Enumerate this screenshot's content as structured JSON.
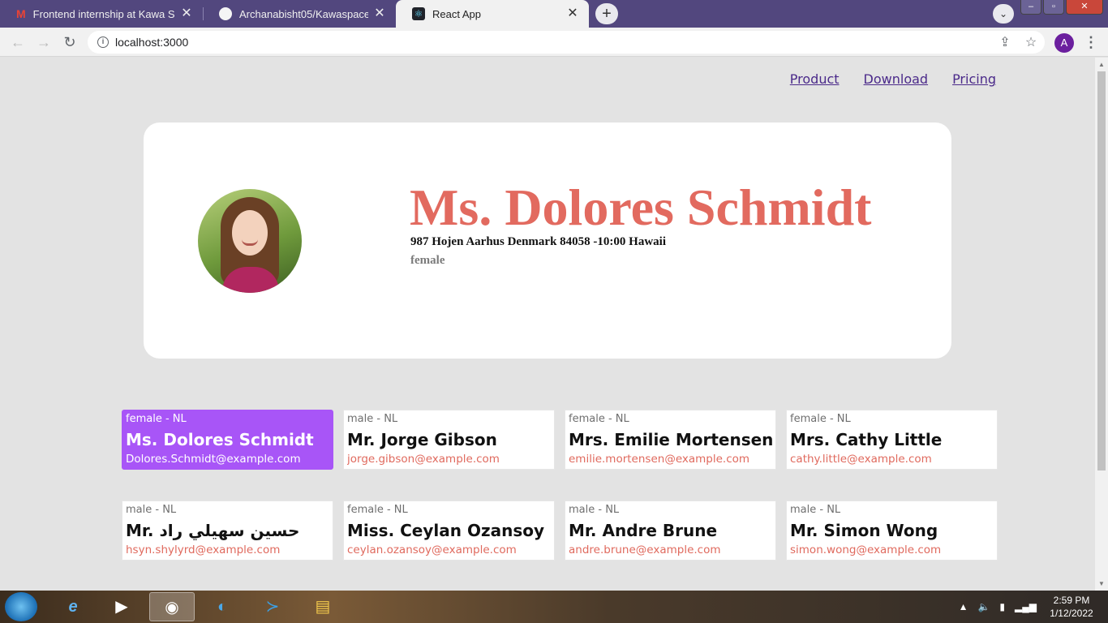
{
  "browser": {
    "tabs": [
      {
        "title": "Frontend internship at Kawa Space",
        "icon": "gmail-icon",
        "active": false
      },
      {
        "title": "Archanabisht05/Kawaspace",
        "icon": "github-icon",
        "active": false
      },
      {
        "title": "React App",
        "icon": "react-icon",
        "active": true
      }
    ],
    "url": "localhost:3000",
    "profile_initial": "A"
  },
  "nav": {
    "links": [
      "Product",
      "Download",
      "Pricing"
    ]
  },
  "profile": {
    "name": "Ms. Dolores Schmidt",
    "address": "987 Hojen Aarhus Denmark 84058 -10:00 Hawaii",
    "gender": "female"
  },
  "cards": [
    {
      "meta": "female - NL",
      "name": "Ms. Dolores Schmidt",
      "email": "Dolores.Schmidt@example.com",
      "selected": true
    },
    {
      "meta": "male - NL",
      "name": "Mr. Jorge Gibson",
      "email": "jorge.gibson@example.com",
      "selected": false
    },
    {
      "meta": "female - NL",
      "name": "Mrs. Emilie Mortensen",
      "email": "emilie.mortensen@example.com",
      "selected": false
    },
    {
      "meta": "female - NL",
      "name": "Mrs. Cathy Little",
      "email": "cathy.little@example.com",
      "selected": false
    },
    {
      "meta": "male - NL",
      "name": "Mr. حسين سهيلي راد",
      "email": "hsyn.shylyrd@example.com",
      "selected": false
    },
    {
      "meta": "female - NL",
      "name": "Miss. Ceylan Ozansoy",
      "email": "ceylan.ozansoy@example.com",
      "selected": false
    },
    {
      "meta": "male - NL",
      "name": "Mr. Andre Brune",
      "email": "andre.brune@example.com",
      "selected": false
    },
    {
      "meta": "male - NL",
      "name": "Mr. Simon Wong",
      "email": "simon.wong@example.com",
      "selected": false
    }
  ],
  "taskbar": {
    "time": "2:59 PM",
    "date": "1/12/2022"
  },
  "colors": {
    "accent_name": "#e26a5f",
    "selected_card": "#a855f7",
    "tabbar": "#52477e"
  }
}
